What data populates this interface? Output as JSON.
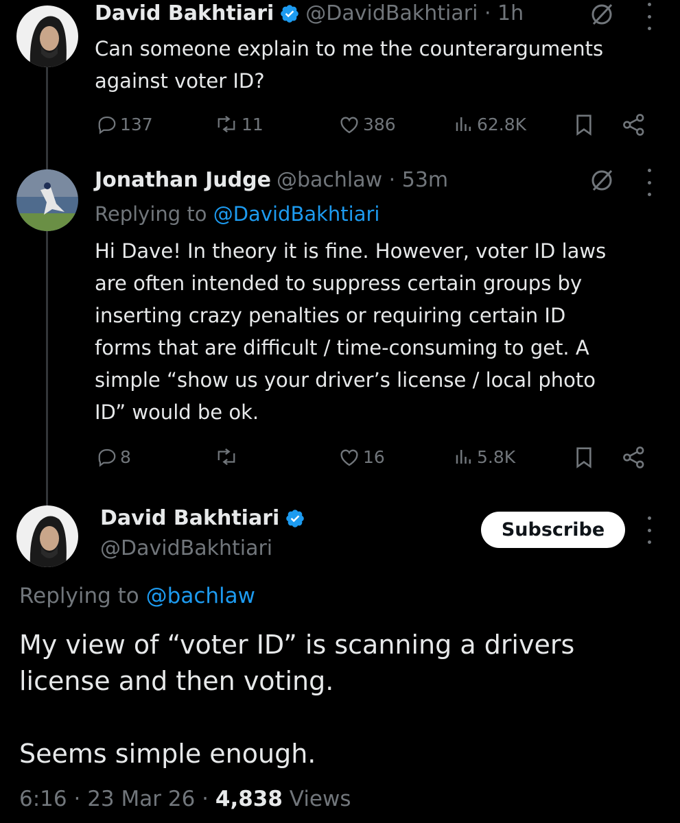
{
  "thread": [
    {
      "author": "David Bakhtiari",
      "handle": "@DavidBakhtiari",
      "time": "1h",
      "text": "Can someone explain to me the counterarguments\nagainst voter ID?",
      "stats": {
        "replies": "137",
        "reposts": "11",
        "likes": "386",
        "views": "62.8K"
      }
    },
    {
      "author": "Jonathan Judge",
      "handle": "@bachlaw",
      "time": "53m",
      "replying_label": "Replying to",
      "replying_to": "@DavidBakhtiari",
      "text": "Hi Dave! In theory it is fine. However, voter ID laws\nare often intended to suppress certain groups by\ninserting crazy penalties or requiring certain ID\nforms that are difficult / time-consuming to get. A\nsimple “show us your driver’s license / local photo\nID” would be ok.",
      "stats": {
        "replies": "8",
        "reposts": "",
        "likes": "16",
        "views": "5.8K"
      }
    }
  ],
  "main_tweet": {
    "author": "David Bakhtiari",
    "handle": "@DavidBakhtiari",
    "subscribe_label": "Subscribe",
    "replying_label": "Replying to",
    "replying_to": "@bachlaw",
    "text": "My view of “voter ID” is scanning a drivers\nlicense and then voting.\n\nSeems simple enough.",
    "time": "6:16",
    "date": "23 Mar 26",
    "views_count": "4,838",
    "views_label": "Views"
  },
  "icons": [
    "verified-badge-icon",
    "grok-icon",
    "more-icon",
    "reply-icon",
    "repost-icon",
    "like-icon",
    "views-icon",
    "bookmark-icon",
    "share-icon"
  ],
  "colors": {
    "background": "#000000",
    "text": "#e7e9ea",
    "muted": "#71767b",
    "link": "#1d9bf0",
    "verified": "#1d9bf0"
  }
}
